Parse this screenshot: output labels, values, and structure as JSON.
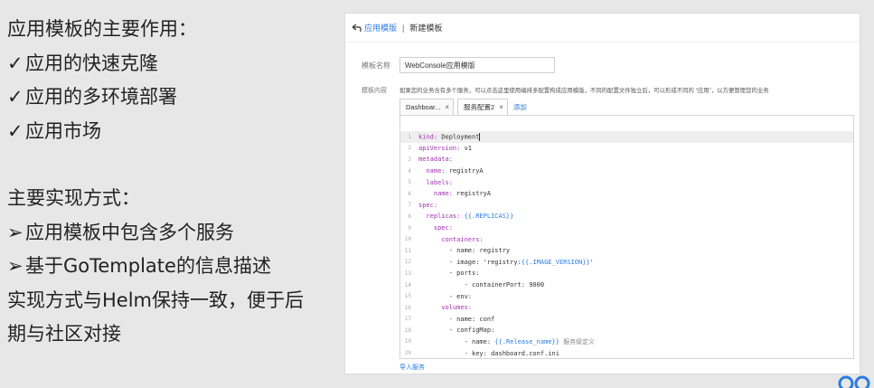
{
  "left_text": {
    "section1_title": "应用模板的主要作用：",
    "checks": [
      "应用的快速克隆",
      "应用的多环境部署",
      "应用市场"
    ],
    "check_mark": "✓",
    "section2_title": "主要实现方式：",
    "arrows": [
      "应用模板中包含多个服务",
      "基于GoTemplate的信息描述"
    ],
    "arrow_mark": "➢",
    "note_line1": "实现方式与Helm保持一致，便于后",
    "note_line2": "期与社区对接"
  },
  "app": {
    "breadcrumb_back": "应用模版",
    "breadcrumb_sep": "|",
    "breadcrumb_current": "新建模板",
    "name_label": "模板名称",
    "name_value": "WebConsole应用模版",
    "content_label": "模板内容",
    "description": "如果您的业务含有多个服务，可以点击这里使用编排多配置构成应用模版，不同的配置文件独立后，可以形成不同的 “应用”，以方便管理您的业务",
    "tabs": [
      {
        "label": "Dashboar...",
        "active": false
      },
      {
        "label": "服务配置2",
        "active": true
      }
    ],
    "tab_close": "×",
    "add_tab": "添加",
    "import_link": "导入服务"
  },
  "code_lines": [
    {
      "n": "1",
      "parts": [
        {
          "c": "k",
          "t": "kind: "
        },
        {
          "c": "v",
          "t": "Deployment"
        }
      ],
      "hl": true
    },
    {
      "n": "2",
      "parts": [
        {
          "c": "k",
          "t": "apiVersion: "
        },
        {
          "c": "v",
          "t": "v1"
        }
      ]
    },
    {
      "n": "3",
      "parts": [
        {
          "c": "k",
          "t": "metadata:"
        }
      ]
    },
    {
      "n": "4",
      "parts": [
        {
          "c": "k",
          "t": "  name: "
        },
        {
          "c": "v",
          "t": "registryA"
        }
      ]
    },
    {
      "n": "5",
      "parts": [
        {
          "c": "k",
          "t": "  labels:"
        }
      ]
    },
    {
      "n": "6",
      "parts": [
        {
          "c": "k",
          "t": "    name: "
        },
        {
          "c": "v",
          "t": "registryA"
        }
      ]
    },
    {
      "n": "7",
      "parts": [
        {
          "c": "k",
          "t": "spec:"
        }
      ]
    },
    {
      "n": "8",
      "parts": [
        {
          "c": "k",
          "t": "  replicas: "
        },
        {
          "c": "t",
          "t": "{{.REPLICAS}}"
        }
      ]
    },
    {
      "n": "9",
      "parts": [
        {
          "c": "k",
          "t": "    spec:"
        }
      ]
    },
    {
      "n": "10",
      "parts": [
        {
          "c": "k",
          "t": "      containers:"
        }
      ]
    },
    {
      "n": "11",
      "parts": [
        {
          "c": "v",
          "t": "        - name: registry"
        }
      ]
    },
    {
      "n": "12",
      "parts": [
        {
          "c": "v",
          "t": "        - image: 'registry:"
        },
        {
          "c": "t",
          "t": "{{.IMAGE_VERSION}}"
        },
        {
          "c": "v",
          "t": "'"
        }
      ]
    },
    {
      "n": "13",
      "parts": [
        {
          "c": "v",
          "t": "        - ports:"
        }
      ]
    },
    {
      "n": "14",
      "parts": [
        {
          "c": "v",
          "t": "            - containerPort: 9000"
        }
      ]
    },
    {
      "n": "15",
      "parts": [
        {
          "c": "v",
          "t": "        - env:"
        }
      ]
    },
    {
      "n": "16",
      "parts": [
        {
          "c": "k",
          "t": "      volumes:"
        }
      ]
    },
    {
      "n": "17",
      "parts": [
        {
          "c": "v",
          "t": "        - name: conf"
        }
      ]
    },
    {
      "n": "18",
      "parts": [
        {
          "c": "v",
          "t": "        - configMap:"
        }
      ]
    },
    {
      "n": "19",
      "parts": [
        {
          "c": "v",
          "t": "            - name: "
        },
        {
          "c": "t",
          "t": "{{.Release_name}}"
        },
        {
          "c": "cm",
          "t": " 服务级定义"
        }
      ]
    },
    {
      "n": "20",
      "parts": [
        {
          "c": "v",
          "t": "            - key: dashboard.conf.ini"
        }
      ]
    }
  ],
  "colors": {
    "accent": "#2b7de0",
    "yaml_key": "#a22fb0",
    "background": "#e7e7e7"
  }
}
